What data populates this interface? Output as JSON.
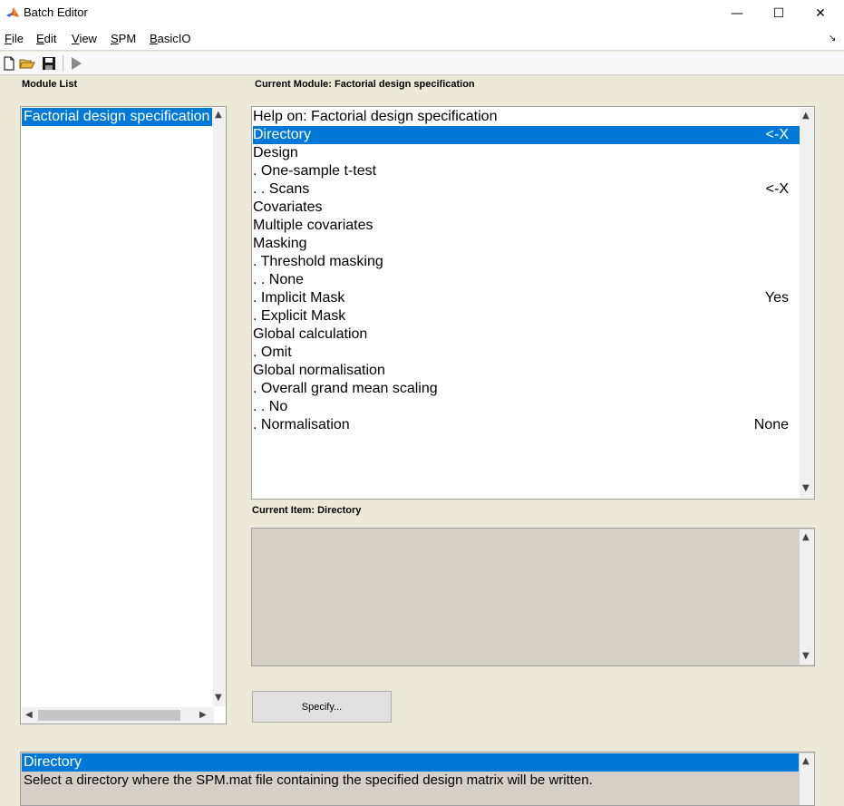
{
  "window": {
    "title": "Batch Editor",
    "minimize_glyph": "—",
    "maximize_glyph": "☐",
    "close_glyph": "✕"
  },
  "menu": {
    "items": [
      {
        "first": "F",
        "rest": "ile"
      },
      {
        "first": "E",
        "rest": "dit"
      },
      {
        "first": "V",
        "rest": "iew"
      },
      {
        "first": "S",
        "rest": "PM"
      },
      {
        "first": "B",
        "rest": "asicIO"
      }
    ],
    "overflow_glyph": "↘"
  },
  "labels": {
    "module_list": "Module List",
    "current_module": "Current Module: Factorial design specification",
    "current_item": "Current Item: Directory"
  },
  "module_list": {
    "items": [
      "Factorial design specification"
    ]
  },
  "module_tree": {
    "rows": [
      {
        "label": "Help on: Factorial design specification",
        "value": "",
        "selected": false
      },
      {
        "label": "Directory",
        "value": "<-X",
        "selected": true
      },
      {
        "label": "Design",
        "value": "",
        "selected": false
      },
      {
        "label": ". One-sample t-test",
        "value": "",
        "selected": false
      },
      {
        "label": ". . Scans",
        "value": "<-X",
        "selected": false
      },
      {
        "label": "Covariates",
        "value": "",
        "selected": false
      },
      {
        "label": "Multiple covariates",
        "value": "",
        "selected": false
      },
      {
        "label": "Masking",
        "value": "",
        "selected": false
      },
      {
        "label": ". Threshold masking",
        "value": "",
        "selected": false
      },
      {
        "label": ". . None",
        "value": "",
        "selected": false
      },
      {
        "label": ". Implicit Mask",
        "value": "Yes",
        "selected": false
      },
      {
        "label": ". Explicit Mask",
        "value": "",
        "selected": false
      },
      {
        "label": "Global calculation",
        "value": "",
        "selected": false
      },
      {
        "label": ". Omit",
        "value": "",
        "selected": false
      },
      {
        "label": "Global normalisation",
        "value": "",
        "selected": false
      },
      {
        "label": ". Overall grand mean scaling",
        "value": "",
        "selected": false
      },
      {
        "label": ". . No",
        "value": "",
        "selected": false
      },
      {
        "label": ". Normalisation",
        "value": "None",
        "selected": false
      }
    ]
  },
  "buttons": {
    "specify": "Specify..."
  },
  "help": {
    "title": "Directory",
    "text": "Select a directory where the SPM.mat file containing the specified design matrix will be written."
  },
  "colors": {
    "selection": "#0078d7",
    "panel_bg": "#ece9d8",
    "readonly_bg": "#d4d0c8"
  }
}
